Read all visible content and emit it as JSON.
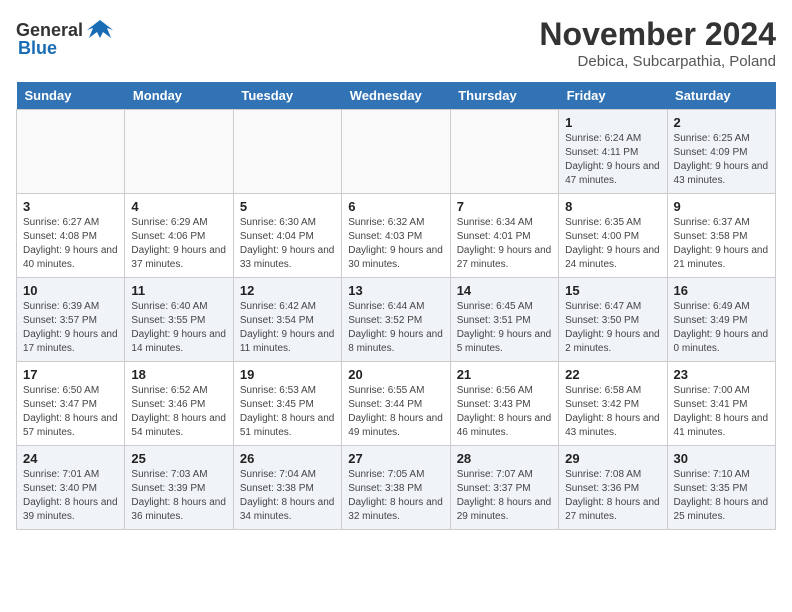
{
  "header": {
    "logo_general": "General",
    "logo_blue": "Blue",
    "month": "November 2024",
    "location": "Debica, Subcarpathia, Poland"
  },
  "weekdays": [
    "Sunday",
    "Monday",
    "Tuesday",
    "Wednesday",
    "Thursday",
    "Friday",
    "Saturday"
  ],
  "weeks": [
    [
      {
        "day": "",
        "info": ""
      },
      {
        "day": "",
        "info": ""
      },
      {
        "day": "",
        "info": ""
      },
      {
        "day": "",
        "info": ""
      },
      {
        "day": "",
        "info": ""
      },
      {
        "day": "1",
        "info": "Sunrise: 6:24 AM\nSunset: 4:11 PM\nDaylight: 9 hours and 47 minutes."
      },
      {
        "day": "2",
        "info": "Sunrise: 6:25 AM\nSunset: 4:09 PM\nDaylight: 9 hours and 43 minutes."
      }
    ],
    [
      {
        "day": "3",
        "info": "Sunrise: 6:27 AM\nSunset: 4:08 PM\nDaylight: 9 hours and 40 minutes."
      },
      {
        "day": "4",
        "info": "Sunrise: 6:29 AM\nSunset: 4:06 PM\nDaylight: 9 hours and 37 minutes."
      },
      {
        "day": "5",
        "info": "Sunrise: 6:30 AM\nSunset: 4:04 PM\nDaylight: 9 hours and 33 minutes."
      },
      {
        "day": "6",
        "info": "Sunrise: 6:32 AM\nSunset: 4:03 PM\nDaylight: 9 hours and 30 minutes."
      },
      {
        "day": "7",
        "info": "Sunrise: 6:34 AM\nSunset: 4:01 PM\nDaylight: 9 hours and 27 minutes."
      },
      {
        "day": "8",
        "info": "Sunrise: 6:35 AM\nSunset: 4:00 PM\nDaylight: 9 hours and 24 minutes."
      },
      {
        "day": "9",
        "info": "Sunrise: 6:37 AM\nSunset: 3:58 PM\nDaylight: 9 hours and 21 minutes."
      }
    ],
    [
      {
        "day": "10",
        "info": "Sunrise: 6:39 AM\nSunset: 3:57 PM\nDaylight: 9 hours and 17 minutes."
      },
      {
        "day": "11",
        "info": "Sunrise: 6:40 AM\nSunset: 3:55 PM\nDaylight: 9 hours and 14 minutes."
      },
      {
        "day": "12",
        "info": "Sunrise: 6:42 AM\nSunset: 3:54 PM\nDaylight: 9 hours and 11 minutes."
      },
      {
        "day": "13",
        "info": "Sunrise: 6:44 AM\nSunset: 3:52 PM\nDaylight: 9 hours and 8 minutes."
      },
      {
        "day": "14",
        "info": "Sunrise: 6:45 AM\nSunset: 3:51 PM\nDaylight: 9 hours and 5 minutes."
      },
      {
        "day": "15",
        "info": "Sunrise: 6:47 AM\nSunset: 3:50 PM\nDaylight: 9 hours and 2 minutes."
      },
      {
        "day": "16",
        "info": "Sunrise: 6:49 AM\nSunset: 3:49 PM\nDaylight: 9 hours and 0 minutes."
      }
    ],
    [
      {
        "day": "17",
        "info": "Sunrise: 6:50 AM\nSunset: 3:47 PM\nDaylight: 8 hours and 57 minutes."
      },
      {
        "day": "18",
        "info": "Sunrise: 6:52 AM\nSunset: 3:46 PM\nDaylight: 8 hours and 54 minutes."
      },
      {
        "day": "19",
        "info": "Sunrise: 6:53 AM\nSunset: 3:45 PM\nDaylight: 8 hours and 51 minutes."
      },
      {
        "day": "20",
        "info": "Sunrise: 6:55 AM\nSunset: 3:44 PM\nDaylight: 8 hours and 49 minutes."
      },
      {
        "day": "21",
        "info": "Sunrise: 6:56 AM\nSunset: 3:43 PM\nDaylight: 8 hours and 46 minutes."
      },
      {
        "day": "22",
        "info": "Sunrise: 6:58 AM\nSunset: 3:42 PM\nDaylight: 8 hours and 43 minutes."
      },
      {
        "day": "23",
        "info": "Sunrise: 7:00 AM\nSunset: 3:41 PM\nDaylight: 8 hours and 41 minutes."
      }
    ],
    [
      {
        "day": "24",
        "info": "Sunrise: 7:01 AM\nSunset: 3:40 PM\nDaylight: 8 hours and 39 minutes."
      },
      {
        "day": "25",
        "info": "Sunrise: 7:03 AM\nSunset: 3:39 PM\nDaylight: 8 hours and 36 minutes."
      },
      {
        "day": "26",
        "info": "Sunrise: 7:04 AM\nSunset: 3:38 PM\nDaylight: 8 hours and 34 minutes."
      },
      {
        "day": "27",
        "info": "Sunrise: 7:05 AM\nSunset: 3:38 PM\nDaylight: 8 hours and 32 minutes."
      },
      {
        "day": "28",
        "info": "Sunrise: 7:07 AM\nSunset: 3:37 PM\nDaylight: 8 hours and 29 minutes."
      },
      {
        "day": "29",
        "info": "Sunrise: 7:08 AM\nSunset: 3:36 PM\nDaylight: 8 hours and 27 minutes."
      },
      {
        "day": "30",
        "info": "Sunrise: 7:10 AM\nSunset: 3:35 PM\nDaylight: 8 hours and 25 minutes."
      }
    ]
  ]
}
